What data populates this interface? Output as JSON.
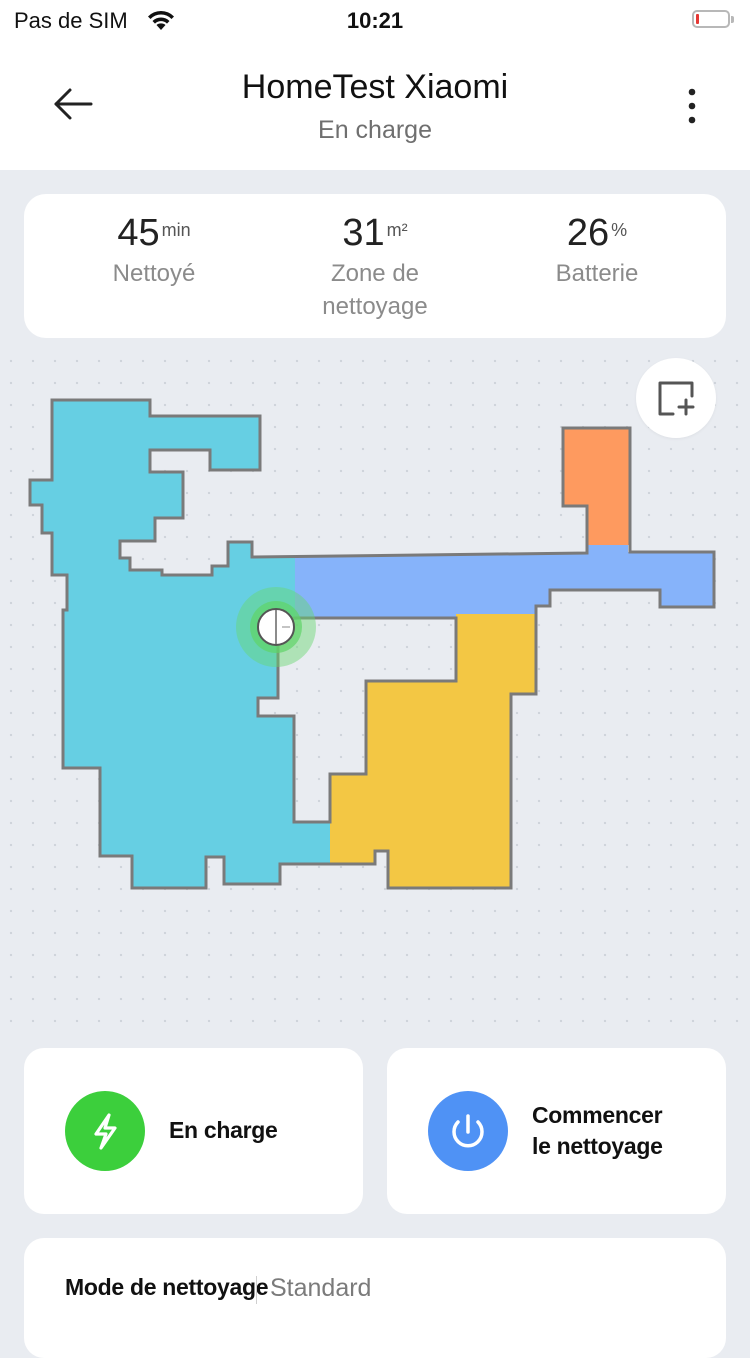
{
  "status_bar": {
    "carrier": "Pas de SIM",
    "time": "10:21",
    "battery_color": "#e53935"
  },
  "header": {
    "title": "HomeTest Xiaomi",
    "subtitle": "En charge",
    "back_icon": "arrow-left-icon",
    "more_icon": "more-vertical-icon"
  },
  "stats": [
    {
      "value": "45",
      "unit": "min",
      "label": "Nettoyé"
    },
    {
      "value": "31",
      "unit": "m²",
      "label": "Zone de nettoyage"
    },
    {
      "value": "26",
      "unit": "%",
      "label": "Batterie"
    }
  ],
  "map": {
    "add_zone_icon": "add-zone-icon",
    "room_colors": {
      "living": "#66cfe3",
      "hallway": "#86b3fa",
      "kitchen": "#f3c744",
      "bathroom": "#fe9a5f"
    },
    "robot_icon": "robot-vacuum-icon"
  },
  "actions": {
    "charge": {
      "label": "En charge",
      "icon": "lightning-icon",
      "color": "#3ccf3c"
    },
    "start": {
      "label_line1": "Commencer",
      "label_line2": "le nettoyage",
      "icon": "power-icon",
      "color": "#4f92f5"
    }
  },
  "mode": {
    "label": "Mode de nettoyage",
    "value": "Standard"
  }
}
